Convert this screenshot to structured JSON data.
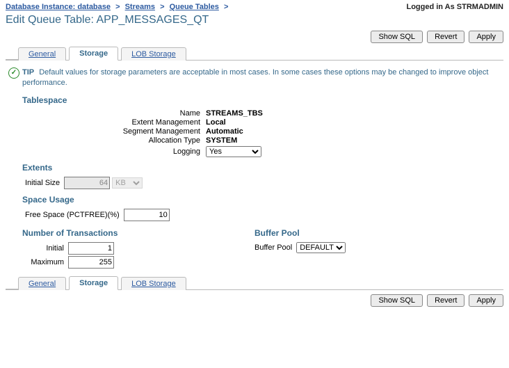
{
  "breadcrumb": {
    "items": [
      "Database Instance: database",
      "Streams",
      "Queue Tables"
    ]
  },
  "header": {
    "logged_in": "Logged in As STRMADMIN",
    "page_title": "Edit Queue Table: APP_MESSAGES_QT"
  },
  "buttons": {
    "show_sql": "Show SQL",
    "revert": "Revert",
    "apply": "Apply"
  },
  "tabs": {
    "general": "General",
    "storage": "Storage",
    "lob_storage": "LOB Storage",
    "active": "storage"
  },
  "tip": {
    "label": "TIP",
    "text": "Default values for storage parameters are acceptable in most cases. In some cases these options may be changed to improve object performance."
  },
  "tablespace": {
    "heading": "Tablespace",
    "name_label": "Name",
    "name_value": "STREAMS_TBS",
    "extent_mgmt_label": "Extent Management",
    "extent_mgmt_value": "Local",
    "segment_mgmt_label": "Segment Management",
    "segment_mgmt_value": "Automatic",
    "alloc_type_label": "Allocation Type",
    "alloc_type_value": "SYSTEM",
    "logging_label": "Logging",
    "logging_value": "Yes"
  },
  "extents": {
    "heading": "Extents",
    "initial_size_label": "Initial Size",
    "initial_size_value": "64",
    "unit_value": "KB"
  },
  "space": {
    "heading": "Space Usage",
    "pctfree_label": "Free Space (PCTFREE)(%)",
    "pctfree_value": "10"
  },
  "trans": {
    "heading": "Number of Transactions",
    "initial_label": "Initial",
    "initial_value": "1",
    "max_label": "Maximum",
    "max_value": "255"
  },
  "buffer": {
    "heading": "Buffer Pool",
    "label": "Buffer Pool",
    "value": "DEFAULT"
  }
}
